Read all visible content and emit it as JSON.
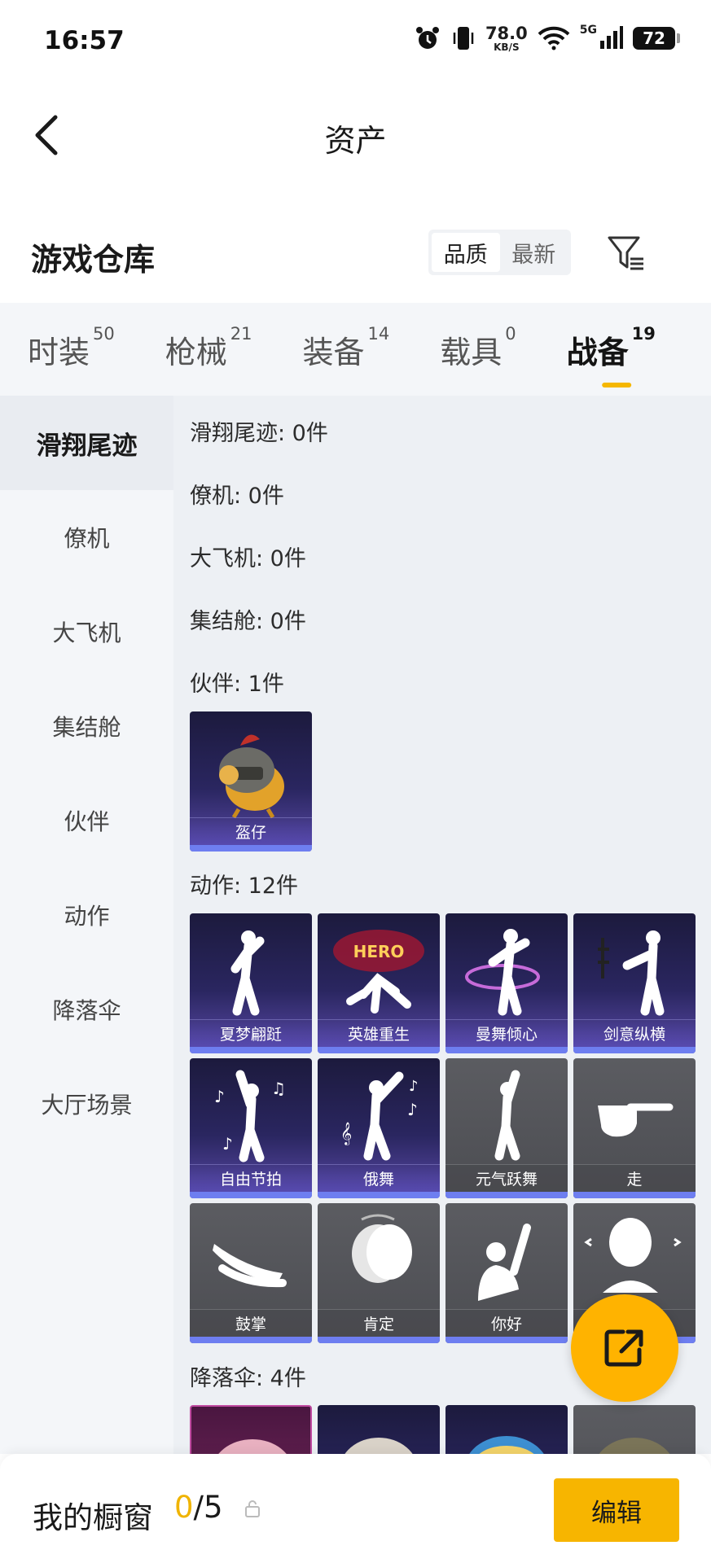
{
  "status_bar": {
    "time": "16:57",
    "net_speed": "78.0",
    "net_unit": "KB/S",
    "net_type": "5G",
    "battery": "72"
  },
  "header": {
    "title": "资产"
  },
  "warehouse": {
    "title": "游戏仓库",
    "sort_options": [
      "品质",
      "最新"
    ],
    "sort_selected": "品质"
  },
  "tabs": [
    {
      "label": "时装",
      "count": "50"
    },
    {
      "label": "枪械",
      "count": "21"
    },
    {
      "label": "装备",
      "count": "14"
    },
    {
      "label": "载具",
      "count": "0"
    },
    {
      "label": "战备",
      "count": "19"
    }
  ],
  "active_tab": "战备",
  "sidebar": {
    "items": [
      "滑翔尾迹",
      "僚机",
      "大飞机",
      "集结舱",
      "伙伴",
      "动作",
      "降落伞",
      "大厅场景"
    ],
    "active": "滑翔尾迹"
  },
  "sections": {
    "glide": "滑翔尾迹: 0件",
    "wingman": "僚机: 0件",
    "plane": "大飞机: 0件",
    "pod": "集结舱: 0件",
    "partner": "伙伴: 1件",
    "emote": "动作: 12件",
    "parachute": "降落伞: 4件"
  },
  "partner_items": [
    "盔仔"
  ],
  "emote_items": [
    "夏梦翩跹",
    "英雄重生",
    "曼舞倾心",
    "剑意纵横",
    "自由节拍",
    "俄舞",
    "元气跃舞",
    "走",
    "鼓掌",
    "肯定",
    "你好",
    ""
  ],
  "bottom": {
    "title": "我的橱窗",
    "current": "0",
    "slash_total": "/5",
    "edit_label": "编辑"
  },
  "colors": {
    "accent": "#f7b500",
    "tab_indicator": "#f5b700",
    "card_purple": "#2a2660",
    "card_bar": "#6e7ef0"
  }
}
